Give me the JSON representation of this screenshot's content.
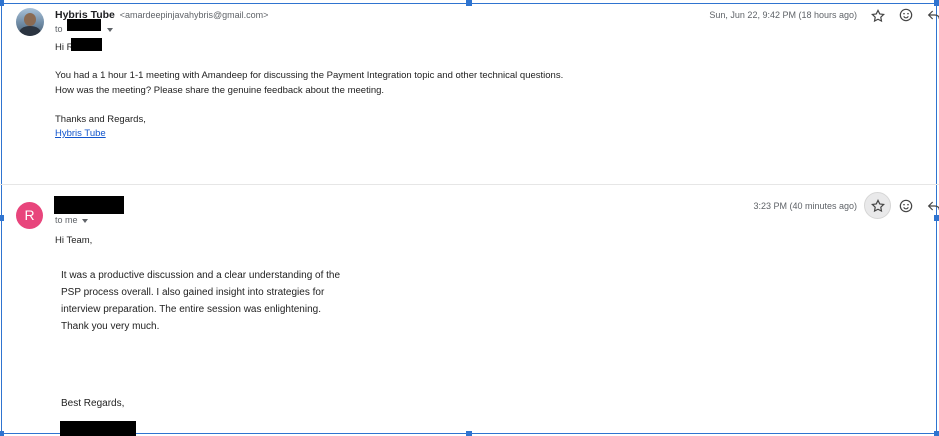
{
  "messages": [
    {
      "sender_name": "Hybris Tube",
      "sender_email": "<amardeepinjavahybris@gmail.com>",
      "to_prefix": "to",
      "date": "Sun, Jun 22, 9:42 PM (18 hours ago)",
      "greeting": "Hi R",
      "body": [
        "You had a 1 hour 1-1 meeting with Amandeep for discussing the Payment Integration topic and other technical questions.",
        "How was the meeting? Please share the genuine feedback about the meeting."
      ],
      "closing": "Thanks and Regards,",
      "signature_link": "Hybris Tube"
    },
    {
      "avatar_letter": "R",
      "to_line": "to me",
      "date": "3:23 PM (40 minutes ago)",
      "greeting": "Hi Team,",
      "body": [
        "It was a productive discussion and a clear understanding of the",
        "PSP process overall. I also gained insight into strategies for",
        "interview preparation. The entire session was enlightening.",
        "Thank you very much."
      ],
      "closing": "Best Regards,"
    }
  ],
  "icons": {
    "star": "star-icon",
    "emoji": "emoji-icon",
    "reply": "reply-icon"
  },
  "colors": {
    "avatar_r": "#e8457c",
    "link": "#1155cc",
    "selection": "#2f74d0"
  }
}
